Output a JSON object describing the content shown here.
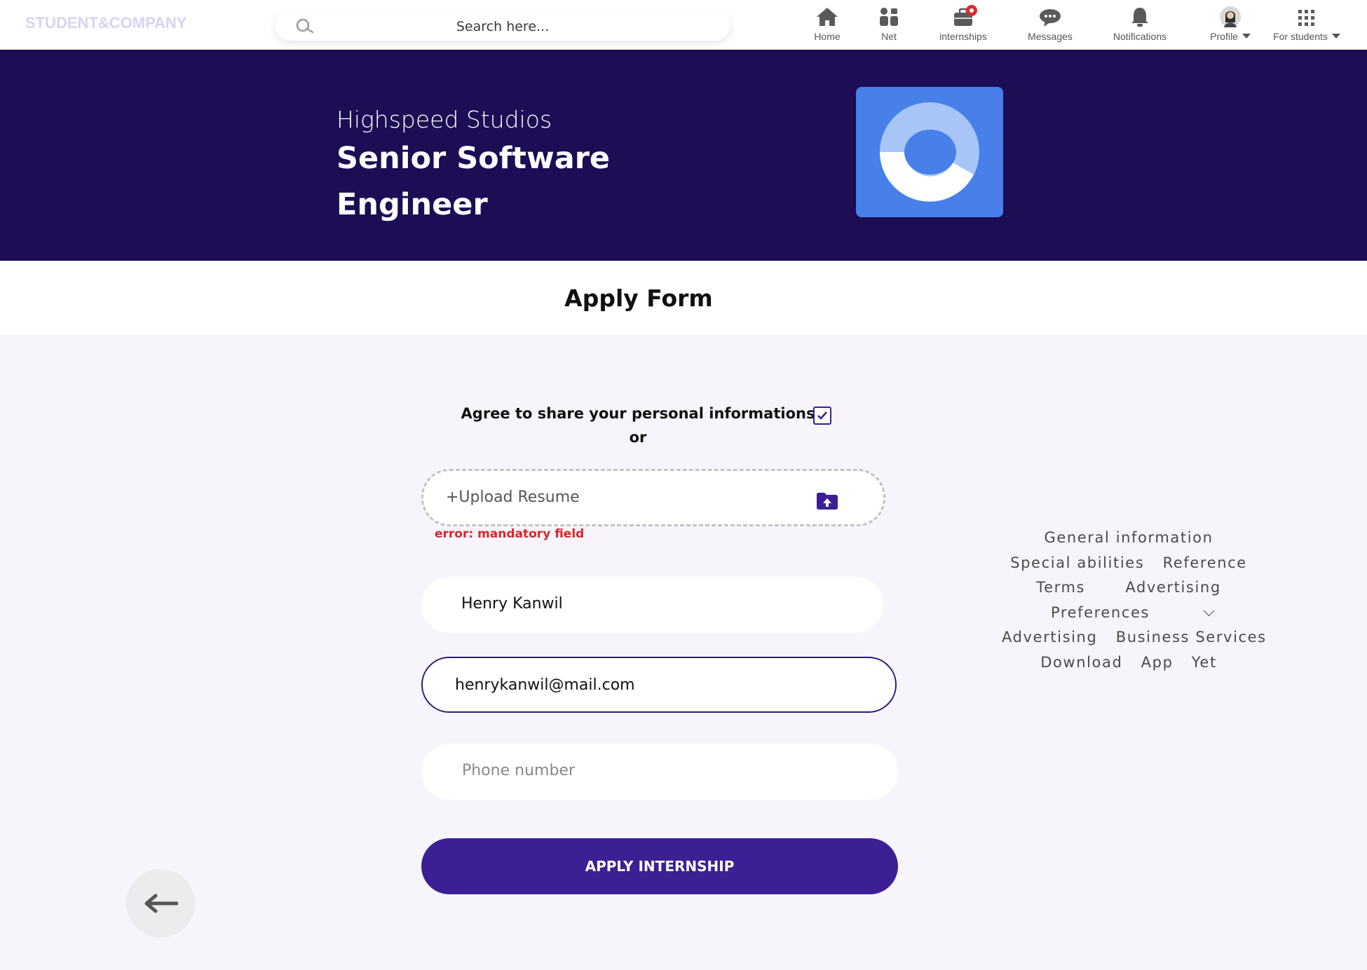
{
  "app": {
    "logo": "STUDENT&COMPANY"
  },
  "search": {
    "placeholder": "Search  here..."
  },
  "nav": {
    "items": [
      {
        "label": "Home",
        "icon": "home-icon"
      },
      {
        "label": "Net",
        "icon": "network-icon"
      },
      {
        "label": "internships",
        "icon": "briefcase-icon"
      },
      {
        "label": "Messages",
        "icon": "chat-icon"
      },
      {
        "label": "Notifications",
        "icon": "bell-icon"
      },
      {
        "label": "Profile",
        "icon": "avatar"
      },
      {
        "label": "For students",
        "icon": "grid-icon"
      }
    ]
  },
  "job": {
    "company": "Highspeed Studios",
    "title": "Senior Software Engineer"
  },
  "form": {
    "title": "Apply Form",
    "agree_text": "Agree to share your personal informations",
    "agree_checked": true,
    "or_text": "or",
    "upload_label": "+Upload Resume",
    "upload_error": "error: mandatory field",
    "name_value": "Henry Kanwil",
    "email_value": "henrykanwil@mail.com",
    "phone_placeholder": "Phone number",
    "submit_label": "APPLY INTERNSHIP"
  },
  "footer_links": {
    "row1": [
      "General information"
    ],
    "row2": [
      "Special abilities",
      "Reference"
    ],
    "row3": [
      "Terms",
      "Advertising"
    ],
    "row4": [
      "Preferences"
    ],
    "row5": [
      "Advertising",
      "Business Services"
    ],
    "row6": [
      "Download",
      "App",
      "Yet"
    ]
  },
  "colors": {
    "brand_dark": "#1c0d54",
    "brand_primary": "#3c1f94",
    "company_logo": "#4680e8",
    "error": "#d8262c",
    "notification_badge": "#d32f2f"
  }
}
